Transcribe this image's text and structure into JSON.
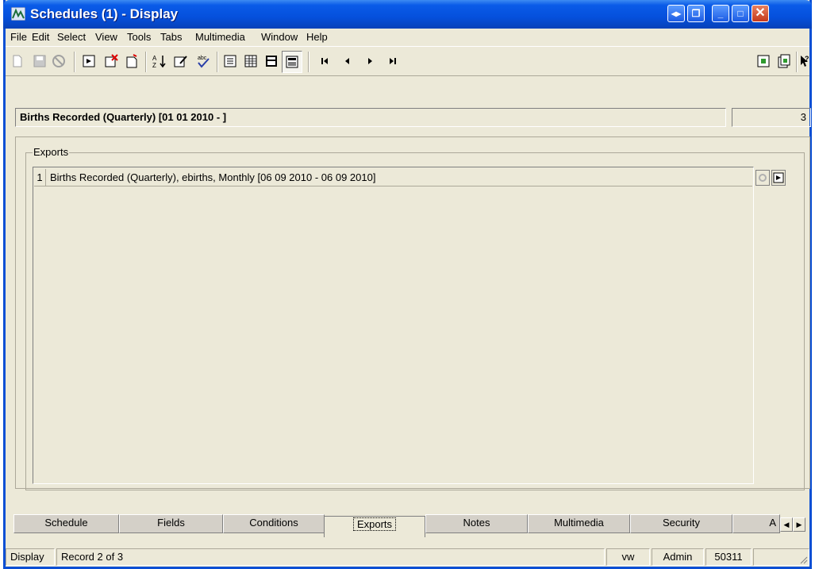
{
  "window": {
    "title": "Schedules (1) - Display",
    "controls": [
      "nav-toggle",
      "restore-down",
      "minimize",
      "maximize",
      "close"
    ],
    "close_glyph": "✕"
  },
  "menu": {
    "items": [
      {
        "label": "File"
      },
      {
        "label": "Edit"
      },
      {
        "label": "Select"
      },
      {
        "label": "View"
      },
      {
        "label": "Tools"
      },
      {
        "label": "Tabs"
      },
      {
        "label": "Multimedia"
      },
      {
        "label": "Window"
      },
      {
        "label": "Help"
      }
    ]
  },
  "toolbar": {
    "icons": [
      "new-record-icon",
      "save-icon",
      "cancel-icon",
      "record-icon",
      "delete-record-icon",
      "new-page-icon",
      "sort-icon",
      "edit-icon",
      "spellcheck-icon",
      "view-form-icon",
      "view-list-icon",
      "view-summary-icon",
      "view-image-icon",
      "first-record-icon",
      "previous-record-icon",
      "next-record-icon",
      "last-record-icon",
      "attach-icon",
      "copy-icon",
      "help-icon"
    ]
  },
  "header": {
    "record_title": "Births Recorded (Quarterly) [01 01 2010 - ]",
    "record_count": "3"
  },
  "exports": {
    "group_label": "Exports",
    "rows": [
      {
        "num": "1",
        "text": "Births Recorded (Quarterly), ebirths, Monthly [06 09 2010 - 06 09 2010]"
      }
    ]
  },
  "tabs": [
    {
      "label": "Schedule"
    },
    {
      "label": "Fields"
    },
    {
      "label": "Conditions"
    },
    {
      "label": "Exports",
      "active": true
    },
    {
      "label": "Notes"
    },
    {
      "label": "Multimedia"
    },
    {
      "label": "Security"
    },
    {
      "label": "A"
    }
  ],
  "tab_arrows": {
    "left": "◀",
    "right": "▶"
  },
  "status": {
    "mode": "Display",
    "record": "Record 2 of 3",
    "user_short": "vw",
    "role": "Admin",
    "code": "50311"
  }
}
